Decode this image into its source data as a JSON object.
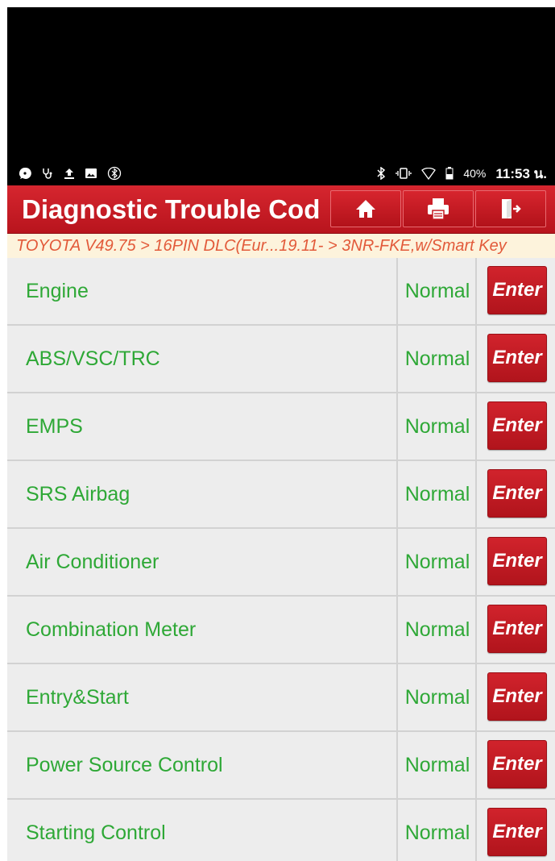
{
  "status_bar": {
    "left_icons": [
      "chat-icon",
      "stethoscope-icon",
      "upload-icon",
      "image-icon",
      "bluetooth-circle-icon"
    ],
    "right_icons": [
      "bluetooth-icon",
      "vibrate-icon",
      "wifi-icon",
      "battery-icon"
    ],
    "battery": "40%",
    "time": "11:53 น."
  },
  "header": {
    "title": "Diagnostic Trouble Cod",
    "buttons": [
      {
        "icon": "home-icon"
      },
      {
        "icon": "print-icon"
      },
      {
        "icon": "exit-icon"
      }
    ]
  },
  "breadcrumb": "TOYOTA V49.75 > 16PIN DLC(Eur...19.11- > 3NR-FKE,w/Smart Key",
  "systems": [
    {
      "name": "Engine",
      "status": "Normal",
      "action": "Enter"
    },
    {
      "name": "ABS/VSC/TRC",
      "status": "Normal",
      "action": "Enter"
    },
    {
      "name": "EMPS",
      "status": "Normal",
      "action": "Enter"
    },
    {
      "name": "SRS Airbag",
      "status": "Normal",
      "action": "Enter"
    },
    {
      "name": "Air Conditioner",
      "status": "Normal",
      "action": "Enter"
    },
    {
      "name": "Combination Meter",
      "status": "Normal",
      "action": "Enter"
    },
    {
      "name": "Entry&Start",
      "status": "Normal",
      "action": "Enter"
    },
    {
      "name": "Power Source Control",
      "status": "Normal",
      "action": "Enter"
    },
    {
      "name": "Starting Control",
      "status": "Normal",
      "action": "Enter"
    }
  ],
  "colors": {
    "brand_red": "#c41a22",
    "status_green": "#2ea836",
    "breadcrumb_text": "#e25a3a",
    "breadcrumb_bg": "#fdf3dc"
  }
}
